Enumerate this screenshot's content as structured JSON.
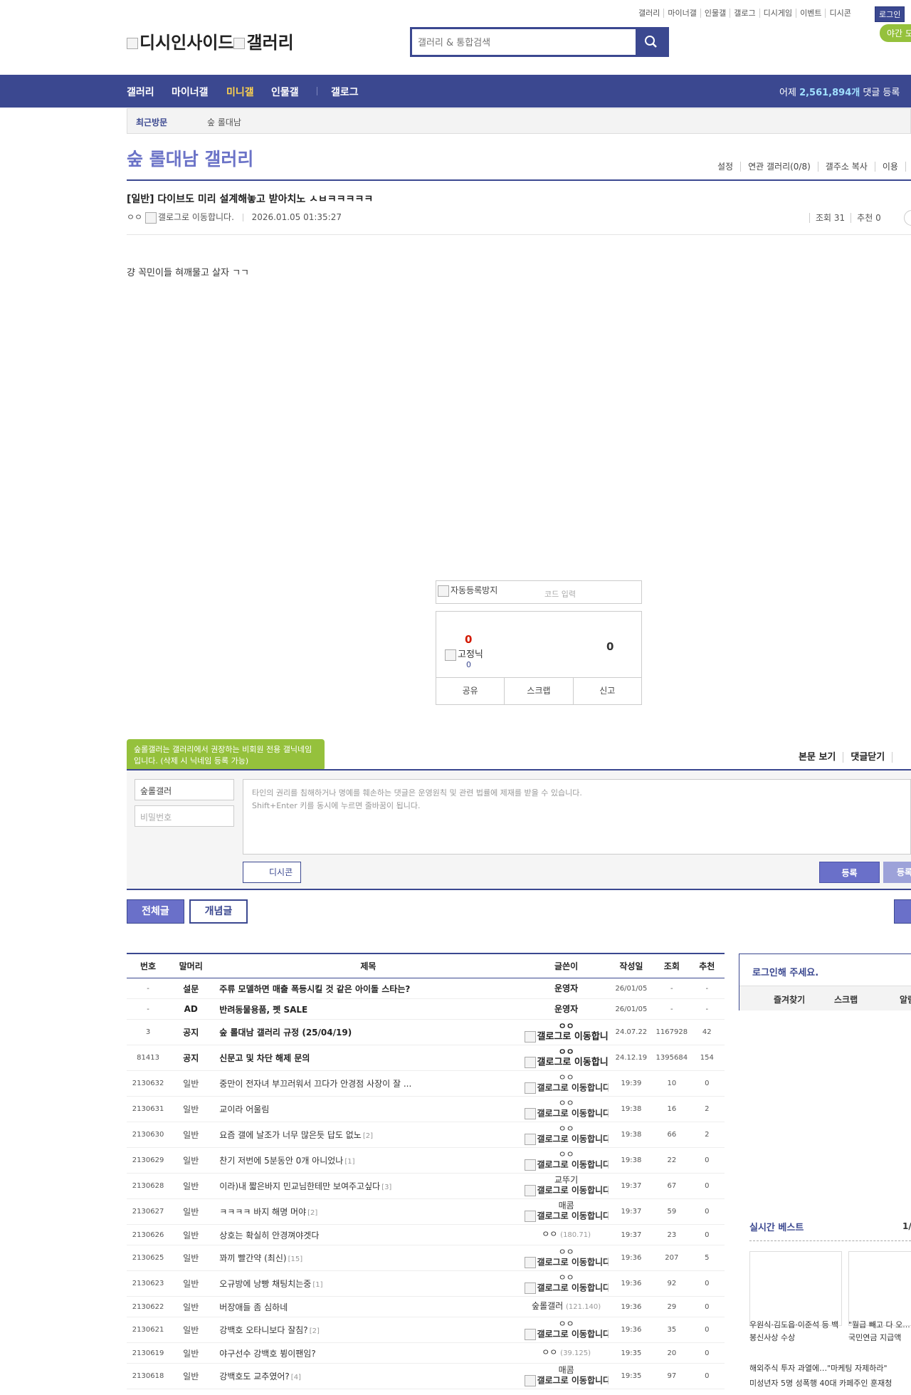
{
  "top_links": [
    "갤러리",
    "마이너갤",
    "인물갤",
    "갤로그",
    "디시게임",
    "이벤트",
    "디시콘"
  ],
  "login_label": "로그인",
  "night_mode_label": "야간 모",
  "logo_text": "디시인사이드",
  "logo_sub": "갤러리",
  "search_placeholder": "갤러리 & 통합검색",
  "nav": {
    "items": [
      "갤러리",
      "마이너갤",
      "미니갤",
      "인물갤",
      "갤로그"
    ],
    "active": "미니갤",
    "stats_prefix": "어제",
    "stats_value": "2,561,894개",
    "stats_suffix": "댓글 등록"
  },
  "recent": {
    "label": "최근방문",
    "item": "숲 롤대남"
  },
  "gallery": {
    "title": "숲 롤대남 갤러리",
    "tools": [
      "설정",
      "연관 갤러리(0/8)",
      "갤주소 복사",
      "이용"
    ]
  },
  "post": {
    "title": "[일반] 다이브도 미리 설계해놓고 받아치노 ㅅㅂㅋㅋㅋㅋㅋ",
    "author": "ㅇㅇ",
    "author_img_alt": "갤로그로 이동합니다.",
    "date": "2026.01.05 01:35:27",
    "views": "조회 31",
    "recommend": "추천 0",
    "body": "걍 꼭민이들 혀깨물고 살자 ㄱㄱ"
  },
  "vote": {
    "captcha_alt": "자동등록방지",
    "captcha_placeholder": "코드 입력",
    "up_count": "0",
    "fixed_nick_alt": "고정닉",
    "fixed_count": "0",
    "down_count": "0",
    "actions": [
      "공유",
      "스크랩",
      "신고"
    ]
  },
  "comment": {
    "tooltip": "숲롤갤러는 갤러리에서 권장하는 비회원 전용 갤닉네임입니다. (삭제 시 닉네임 등록 가능)",
    "tools": [
      "본문 보기",
      "댓글닫기"
    ],
    "nick_value": "숲롤갤러",
    "pw_placeholder": "비밀번호",
    "text_placeholder": "타인의 권리를 침해하거나 명예를 훼손하는 댓글은 운영원칙 및 관련 법률에 제재를 받을 수 있습니다.\nShift+Enter 키를 동시에 누르면 줄바꿈이 됩니다.",
    "dccon_label": "디시콘",
    "submit_label": "등록",
    "submit2_label": "등록"
  },
  "tabs": {
    "all": "전체글",
    "concept": "개념글"
  },
  "list": {
    "headers": [
      "번호",
      "말머리",
      "제목",
      "글쓴이",
      "작성일",
      "조회",
      "추천"
    ],
    "rows": [
      {
        "num": "-",
        "head": "설문",
        "title": "주류 모델하면 매출 폭등시킬 것 같은 아이돌 스타는?",
        "cnt": "",
        "writer": "운영자",
        "ip": "",
        "img": "",
        "date": "26/01/05",
        "views": "-",
        "rec": "-",
        "notice": true
      },
      {
        "num": "-",
        "head": "AD",
        "title": "반려동물용품, 펫 SALE",
        "cnt": "",
        "writer": "운영자",
        "ip": "",
        "img": "",
        "date": "26/01/05",
        "views": "-",
        "rec": "-",
        "notice": true
      },
      {
        "num": "3",
        "head": "공지",
        "title": "숲 롤대남 갤러리 규정 (25/04/19)",
        "cnt": "",
        "writer": "ㅇㅇ",
        "ip": "",
        "img": "갤로그로 이동합니다.",
        "date": "24.07.22",
        "views": "1167928",
        "rec": "42",
        "notice": true
      },
      {
        "num": "81413",
        "head": "공지",
        "title": "신문고 및 차단 해제 문의",
        "cnt": "",
        "writer": "ㅇㅇ",
        "ip": "",
        "img": "갤로그로 이동합니다.",
        "date": "24.12.19",
        "views": "1395684",
        "rec": "154",
        "notice": true
      },
      {
        "num": "2130632",
        "head": "일반",
        "title": "중만이 전자녀 부끄러워서 끄다가 안경점 사장이 잘 ...",
        "cnt": "",
        "writer": "ㅇㅇ",
        "ip": "",
        "img": "갤로그로 이동합니다.",
        "date": "19:39",
        "views": "10",
        "rec": "0"
      },
      {
        "num": "2130631",
        "head": "일반",
        "title": "교이라 어울림",
        "cnt": "",
        "writer": "ㅇㅇ",
        "ip": "",
        "img": "갤로그로 이동합니다.",
        "date": "19:38",
        "views": "16",
        "rec": "2"
      },
      {
        "num": "2130630",
        "head": "일반",
        "title": "요즘 갤에 날조가 너무 많은듯 답도 없노",
        "cnt": "[2]",
        "writer": "ㅇㅇ",
        "ip": "",
        "img": "갤로그로 이동합니다.",
        "date": "19:38",
        "views": "66",
        "rec": "2"
      },
      {
        "num": "2130629",
        "head": "일반",
        "title": "찬기 저번에 5분동안 0개 아니었나",
        "cnt": "[1]",
        "writer": "ㅇㅇ",
        "ip": "",
        "img": "갤로그로 이동합니다.",
        "date": "19:38",
        "views": "22",
        "rec": "0"
      },
      {
        "num": "2130628",
        "head": "일반",
        "title": "이라)내 짧은바지 민교님한테만 보여주고싶다",
        "cnt": "[3]",
        "writer": "교뚜기",
        "ip": "",
        "img": "갤로그로 이동합니다.",
        "date": "19:37",
        "views": "67",
        "rec": "0"
      },
      {
        "num": "2130627",
        "head": "일반",
        "title": "ㅋㅋㅋㅋ 바지 해명 머야",
        "cnt": "[2]",
        "writer": "매콤",
        "ip": "",
        "img": "갤로그로 이동합니다.",
        "date": "19:37",
        "views": "59",
        "rec": "0"
      },
      {
        "num": "2130626",
        "head": "일반",
        "title": "상호는 확실히 안경껴야겟다",
        "cnt": "",
        "writer": "ㅇㅇ",
        "ip": "(180.71)",
        "img": "",
        "date": "19:37",
        "views": "23",
        "rec": "0"
      },
      {
        "num": "2130625",
        "head": "일반",
        "title": "꽈끼 빨간약 (최신)",
        "cnt": "[15]",
        "writer": "ㅇㅇ",
        "ip": "",
        "img": "갤로그로 이동합니다.",
        "date": "19:36",
        "views": "207",
        "rec": "5"
      },
      {
        "num": "2130623",
        "head": "일반",
        "title": "오규방에 낭빵 채팅치는중",
        "cnt": "[1]",
        "writer": "ㅇㅇ",
        "ip": "",
        "img": "갤로그로 이동합니다.",
        "date": "19:36",
        "views": "92",
        "rec": "0"
      },
      {
        "num": "2130622",
        "head": "일반",
        "title": "버장애들 좀 심하네",
        "cnt": "",
        "writer": "숲롤갤러",
        "ip": "(121.140)",
        "img": "",
        "date": "19:36",
        "views": "29",
        "rec": "0"
      },
      {
        "num": "2130621",
        "head": "일반",
        "title": "강백호 오타니보다 잘침?",
        "cnt": "[2]",
        "writer": "ㅇㅇ",
        "ip": "",
        "img": "갤로그로 이동합니다.",
        "date": "19:36",
        "views": "35",
        "rec": "0"
      },
      {
        "num": "2130619",
        "head": "일반",
        "title": "야구선수 강백호 뷩이팬임?",
        "cnt": "",
        "writer": "ㅇㅇ",
        "ip": "(39.125)",
        "img": "",
        "date": "19:35",
        "views": "20",
        "rec": "0"
      },
      {
        "num": "2130618",
        "head": "일반",
        "title": "강백호도 교추였어?",
        "cnt": "[4]",
        "writer": "매콤",
        "ip": "",
        "img": "갤로그로 이동합니다.",
        "date": "19:35",
        "views": "97",
        "rec": "0"
      }
    ]
  },
  "sidebar": {
    "login_prompt": "로그인해 주세요.",
    "login_links": [
      "즐겨찾기",
      "스크랩",
      "알림"
    ],
    "best_title": "실시간 베스트",
    "best_page": "1/",
    "best_captions": [
      "우원식·김도읍·이준석 등 백봉신사상 수상",
      "\"월급 빼고 다 오... 국민연금 지급액"
    ],
    "news": [
      "해외주식 투자 과열에…\"마케팅 자제하라\"",
      "미성년자 5명 성폭행 40대 카페주인 훈재청"
    ]
  }
}
